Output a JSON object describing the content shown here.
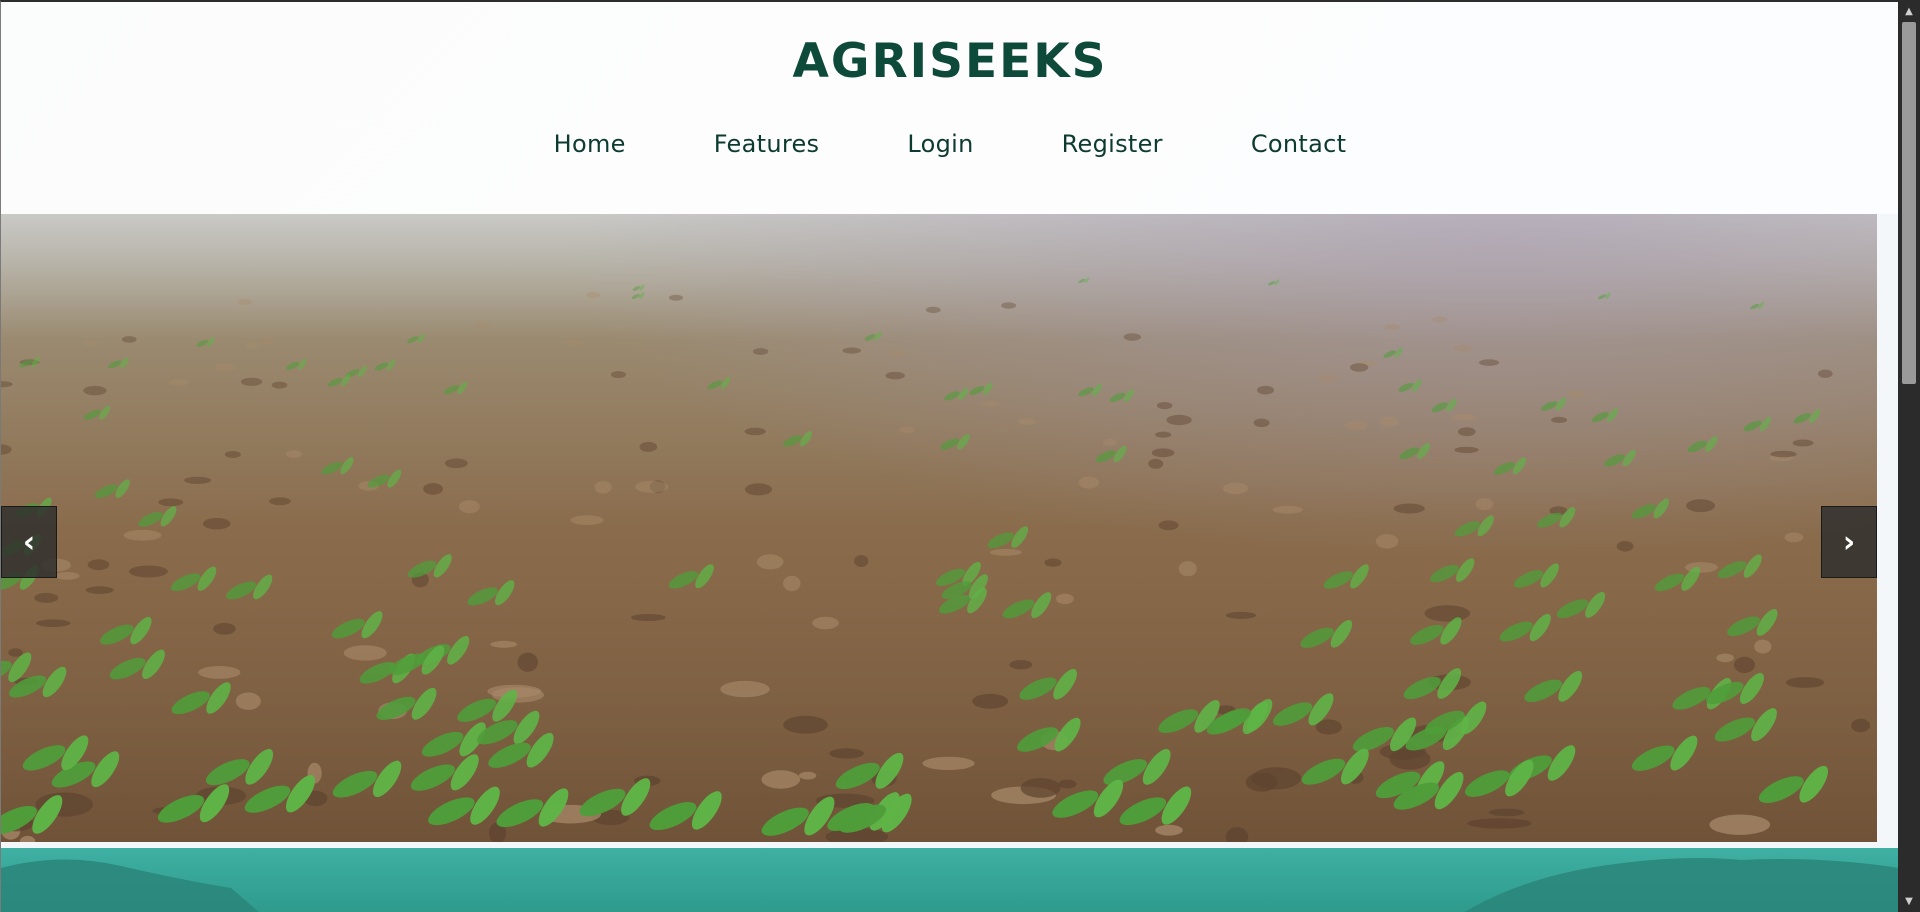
{
  "brand": {
    "title": "AGRISEEKS",
    "color": "#0d4a3a"
  },
  "nav": {
    "items": [
      {
        "label": "Home"
      },
      {
        "label": "Features"
      },
      {
        "label": "Login"
      },
      {
        "label": "Register"
      },
      {
        "label": "Contact"
      }
    ]
  },
  "carousel": {
    "image": "seedlings-in-soil-field",
    "prev_icon": "‹",
    "next_icon": "›"
  },
  "scrollbar": {
    "up_icon": "▲",
    "down_icon": "▼"
  },
  "colors": {
    "band_top": "#3fb0a3",
    "band_bottom": "#2d9a8c",
    "soil": "#8b6a4a",
    "sprout": "#4f9e3a"
  }
}
